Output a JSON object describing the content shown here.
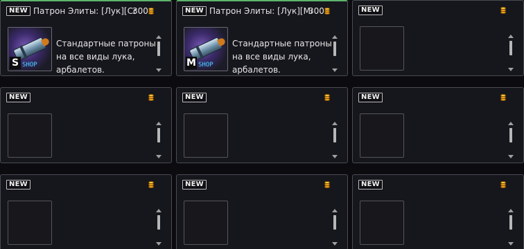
{
  "new_badge": "NEW",
  "coin_icon": "gold-coin-stack-icon",
  "colors": {
    "card_bg": "#16161d",
    "card_border": "#4b4b52",
    "top_accent": "#5db56c",
    "coin": "#f0a020"
  },
  "cards": [
    {
      "title": "Патрон Элиты: [Лук][Со..",
      "price": "300",
      "grade": "S",
      "shop": "SHOP",
      "desc": "Стандартные патроны на все виды лука, арбалетов."
    },
    {
      "title": "Патрон Элиты: [Лук][Ма..",
      "price": "300",
      "grade": "M",
      "shop": "SHOP",
      "desc": "Стандартные патроны на все виды лука, арбалетов."
    }
  ]
}
